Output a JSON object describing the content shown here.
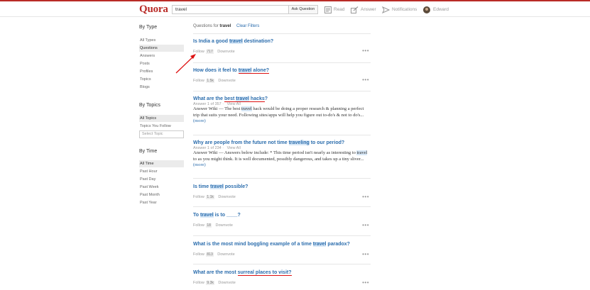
{
  "header": {
    "logo": "Quora",
    "search_value": "travel",
    "ask_label": "Ask Question",
    "nav": {
      "read": "Read",
      "answer": "Answer",
      "notifications": "Notifications",
      "user": "Edward"
    }
  },
  "sidebar": {
    "by_type": {
      "heading": "By Type",
      "items": [
        "All Types",
        "Questions",
        "Answers",
        "Posts",
        "Profiles",
        "Topics",
        "Blogs"
      ]
    },
    "by_topics": {
      "heading": "By Topics",
      "items": [
        "All Topics",
        "Topics You Follow"
      ],
      "select_placeholder": "Select Topic"
    },
    "by_time": {
      "heading": "By Time",
      "items": [
        "All Time",
        "Past Hour",
        "Past Day",
        "Past Week",
        "Past Month",
        "Past Year"
      ]
    }
  },
  "main": {
    "filter_prefix": "Questions for",
    "filter_term": "travel",
    "clear_filters": "Clear Filters",
    "follow_label": "Follow",
    "downvote_label": "Downvote",
    "more_label": "(more)",
    "questions": [
      {
        "parts": [
          "Is India a good ",
          "travel",
          " destination?"
        ],
        "count": "717"
      },
      {
        "parts": [
          "How does it feel to ",
          "travel",
          " alone?"
        ],
        "count": "1.5k"
      },
      {
        "parts": [
          "What are the ",
          "best ",
          "travel",
          " hacks",
          "?"
        ],
        "answer_info": "Answer 1 of 357",
        "view_all": "View All",
        "text_parts": [
          "Answer Wiki — The best ",
          "travel",
          " hack would be doing a proper research & planning a perfect trip that suits your need. Following sites/apps will help you figure out to-do's & not to do's... "
        ]
      },
      {
        "parts": [
          "Why are people from the future not time ",
          "traveling",
          " to our period?"
        ],
        "answer_info": "Answer 1 of 234",
        "view_all": "View All",
        "text_parts": [
          "Answer Wiki — Answers below include:  * This time period isn't nearly as interesting to ",
          "travel",
          " to as you might think. It is well documented, possibly dangerous, and takes up a tiny sliver... "
        ]
      },
      {
        "parts": [
          "Is time ",
          "travel",
          " possible?"
        ],
        "count": "1.1k"
      },
      {
        "parts": [
          "To ",
          "travel",
          " is to ____?"
        ],
        "count": "18"
      },
      {
        "parts": [
          "What is the most mind boggling example of a time ",
          "travel",
          " paradox?"
        ],
        "count": "813"
      },
      {
        "parts": [
          "What are the most ",
          "surreal places to visit",
          "?"
        ],
        "count": "9.3k"
      }
    ]
  },
  "colors": {
    "brand": "#b92b27",
    "link": "#2b6dad",
    "annotation": "#dd1111"
  }
}
